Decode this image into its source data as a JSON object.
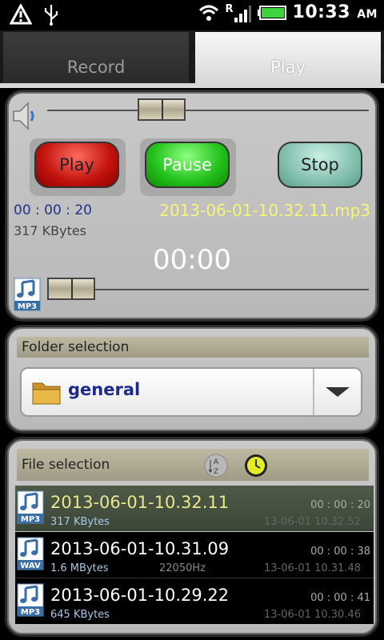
{
  "status": {
    "time": "10:33",
    "ampm": "AM",
    "roaming": "R",
    "icons": [
      "warning-icon",
      "usb-icon",
      "wifi-icon",
      "signal-icon",
      "battery-icon"
    ]
  },
  "tabs": [
    {
      "label": "Record",
      "active": false
    },
    {
      "label": "Play",
      "active": true
    }
  ],
  "player": {
    "buttons": {
      "play": "Play",
      "pause": "Pause",
      "stop": "Stop"
    },
    "duration": "00 : 00 : 20",
    "size": "317 KBytes",
    "filename": "2013-06-01-10.32.11.mp3",
    "position": "00:00",
    "volume_level": 0.33,
    "progress_level": 0.0,
    "format_badge": "MP3"
  },
  "folder": {
    "header": "Folder selection",
    "selected": "general"
  },
  "files": {
    "header": "File selection",
    "items": [
      {
        "name": "2013-06-01-10.32.11",
        "size": "317 KBytes",
        "rate": "",
        "duration": "00 : 00 : 20",
        "date": "13-06-01 10.32.52",
        "format": "MP3",
        "selected": true
      },
      {
        "name": "2013-06-01-10.31.09",
        "size": "1.6 MBytes",
        "rate": "22050Hz",
        "duration": "00 : 00 : 38",
        "date": "13-06-01 10.31.48",
        "format": "WAV",
        "selected": false
      },
      {
        "name": "2013-06-01-10.29.22",
        "size": "645 KBytes",
        "rate": "",
        "duration": "00 : 00 : 41",
        "date": "13-06-01 10.30.46",
        "format": "MP3",
        "selected": false
      }
    ]
  },
  "colors": {
    "accent_yellow": "#f8f478",
    "duration_blue": "#243488",
    "folder_text": "#1c2a8e"
  }
}
